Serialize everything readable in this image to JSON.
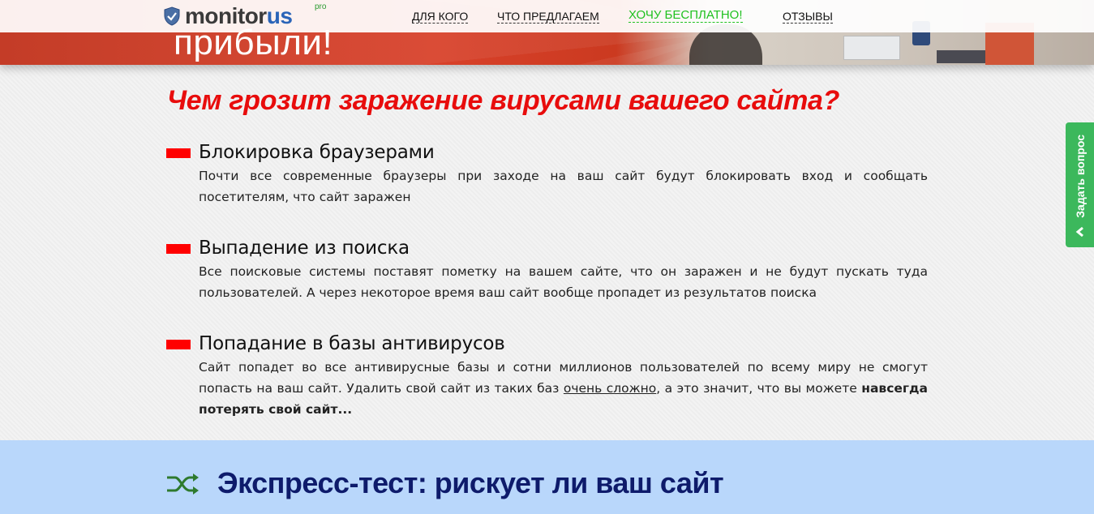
{
  "hero": {
    "text": "прибыли!"
  },
  "logo": {
    "main": "monitor",
    "accent": "us",
    "sup": "pro"
  },
  "nav": {
    "items": [
      {
        "label": "ДЛЯ КОГО"
      },
      {
        "label": "ЧТО ПРЕДЛАГАЕМ"
      },
      {
        "label": "ХОЧУ БЕСПЛАТНО!"
      },
      {
        "label": "ОТЗЫВЫ"
      }
    ]
  },
  "section": {
    "title": "Чем грозит заражение вирусами вашего сайта?",
    "items": [
      {
        "heading": "Блокировка браузерами",
        "text": "Почти все современные браузеры при заходе на ваш сайт будут блокировать вход и сообщать посетителям, что сайт заражен"
      },
      {
        "heading": "Выпадение из поиска",
        "text": "Все поисковые системы поставят пометку на вашем сайте, что он заражен и не будут пускать туда пользователей. А через некоторое время ваш сайт вообще пропадет из результатов поиска"
      },
      {
        "heading": "Попадание в базы антивирусов",
        "text_before": "Сайт попадет во все антивирусные базы и сотни миллионов пользователей по всему миру не смогут попасть на ваш сайт. Удалить свой сайт из таких баз ",
        "text_underline": "очень сложно",
        "text_middle": ", а это значит, что вы можете ",
        "text_bold": "навсегда потерять свой сайт..."
      }
    ]
  },
  "side_tab": {
    "label": "Задать вопрос",
    "icon": "chevron-left-icon"
  },
  "express": {
    "title": "Экспресс-тест: рискует ли ваш сайт",
    "icon": "shuffle-icon"
  },
  "colors": {
    "accent_red": "#e80c0c",
    "bullet_red": "#ff0000",
    "nav_green": "#1fc11f",
    "tab_green": "#3cb85c",
    "express_bg": "#b9d7fb",
    "express_title": "#0e1b6b"
  }
}
